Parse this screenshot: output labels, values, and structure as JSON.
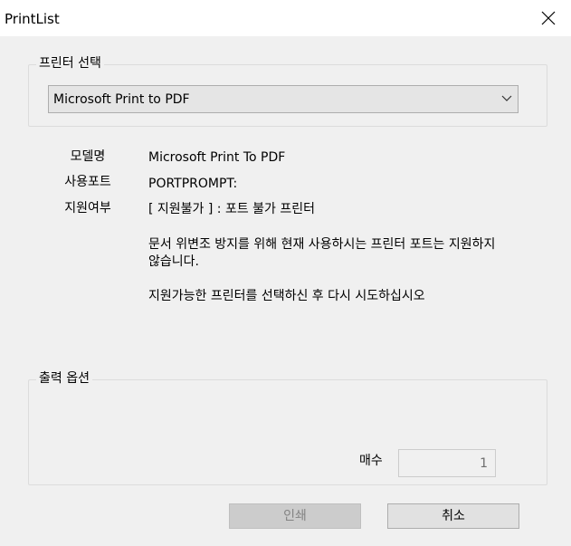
{
  "window": {
    "title": "PrintList"
  },
  "printer_group": {
    "legend": "프린터 선택",
    "selected_printer": "Microsoft Print to PDF"
  },
  "info": {
    "model_label": "모델명",
    "model_value": "Microsoft Print To PDF",
    "port_label": "사용포트",
    "port_value": "PORTPROMPT:",
    "support_label": "지원여부",
    "support_value": "[ 지원불가 ] : 포트 불가 프린터",
    "message_1": "문서 위변조 방지를 위해 현재 사용하시는 프린터 포트는 지원하지 않습니다.",
    "message_2": "지원가능한 프린터를 선택하신 후 다시 시도하십시오"
  },
  "output_group": {
    "legend": "출력 옵션",
    "copies_label": "매수",
    "copies_value": "1"
  },
  "buttons": {
    "print_label": "인쇄",
    "cancel_label": "취소"
  },
  "icons": {
    "close": "close-icon",
    "dropdown": "chevron-down-icon"
  }
}
